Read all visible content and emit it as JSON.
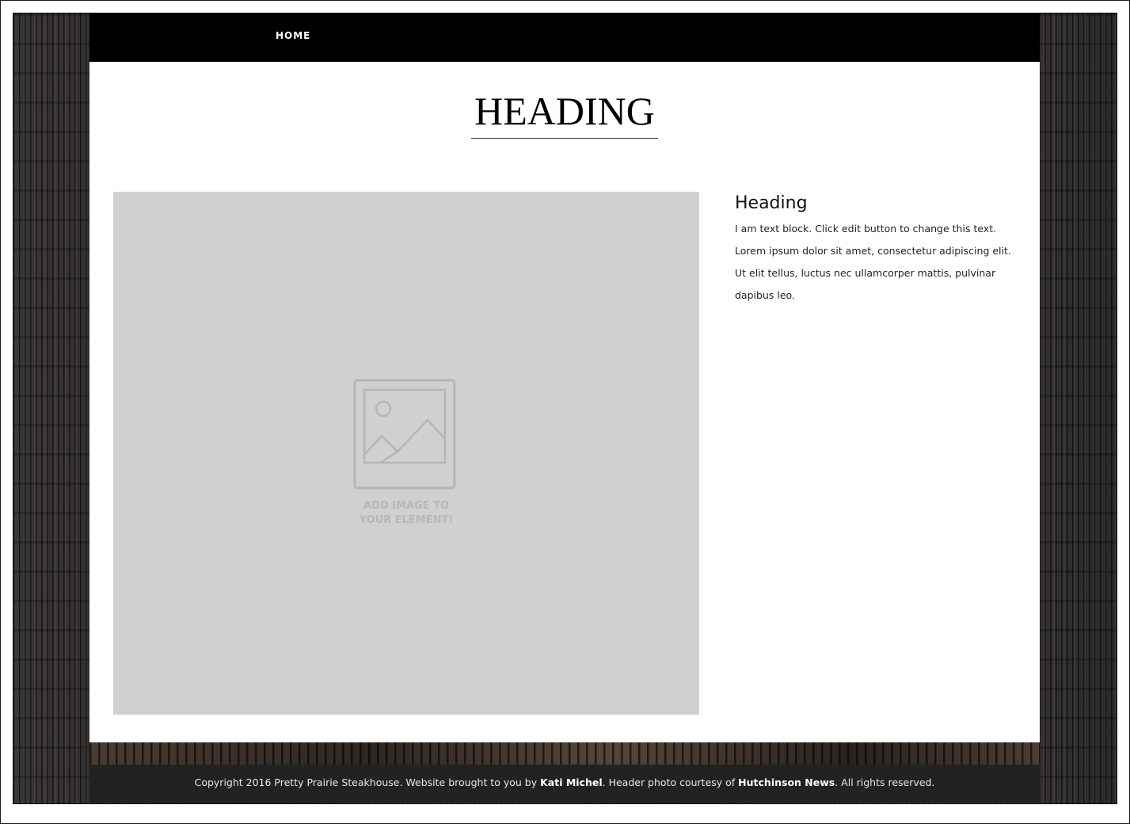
{
  "nav": {
    "home_label": "HOME"
  },
  "page": {
    "title": "HEADING"
  },
  "placeholder": {
    "icon": "image-placeholder-icon",
    "label": "ADD IMAGE TO\nYOUR ELEMENT!"
  },
  "side": {
    "heading": "Heading",
    "text": "I am text block. Click edit button to change this text. Lorem ipsum dolor sit amet, consectetur adipiscing elit. Ut elit tellus, luctus nec ullamcorper mattis, pulvinar dapibus leo."
  },
  "footer": {
    "part1": "Copyright 2016 Pretty Prairie Steakhouse. Website brought to you by ",
    "author": "Kati Michel",
    "part2": ". Header photo courtesy of ",
    "source": "Hutchinson News",
    "part3": ". All rights reserved."
  }
}
